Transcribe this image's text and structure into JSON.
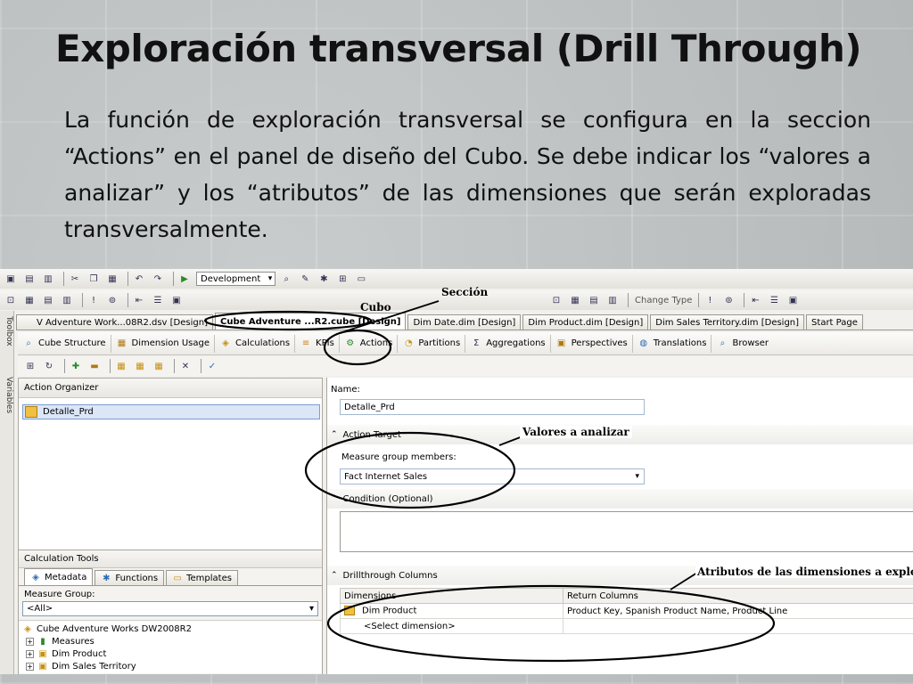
{
  "slide": {
    "title": "Exploración transversal (Drill Through)",
    "body": "La función de exploración transversal se configura en la seccion “Actions” en el panel de diseño del Cubo. Se debe indicar los “valores a analizar” y los “atributos” de las dimensiones que serán exploradas transversalmente."
  },
  "toolbar": {
    "config_dropdown": "Development",
    "change_type": "Change Type"
  },
  "side": {
    "toolbox": "Toolbox",
    "variables": "Variables"
  },
  "doc_tabs": [
    "V Adventure Work...08R2.dsv [Design]",
    "Cube Adventure ...R2.cube [Design]",
    "Dim Date.dim [Design]",
    "Dim Product.dim [Design]",
    "Dim Sales Territory.dim [Design]",
    "Start Page"
  ],
  "design_tabs": [
    "Cube Structure",
    "Dimension Usage",
    "Calculations",
    "KPIs",
    "Actions",
    "Partitions",
    "Aggregations",
    "Perspectives",
    "Translations",
    "Browser"
  ],
  "left": {
    "organizer_title": "Action Organizer",
    "organizer_item": "Detalle_Prd",
    "calc_title": "Calculation Tools",
    "calc_tabs": [
      "Metadata",
      "Functions",
      "Templates"
    ],
    "measure_group_label": "Measure Group:",
    "measure_group_value": "<All>",
    "tree": [
      "Cube Adventure Works DW2008R2",
      "Measures",
      "Dim Product",
      "Dim Sales Territory"
    ]
  },
  "right": {
    "name_label": "Name:",
    "name_value": "Detalle_Prd",
    "action_target": "Action Target",
    "mg_members_label": "Measure group members:",
    "mg_members_value": "Fact Internet Sales",
    "condition": "Condition (Optional)",
    "drill_cols": "Drillthrough Columns",
    "col_dimensions": "Dimensions",
    "col_return": "Return Columns",
    "row1_dim": "Dim Product",
    "row1_return": "Product Key, Spanish Product Name, Product Line",
    "row2_dim": "<Select dimension>"
  },
  "annotations": {
    "seccion": "Sección",
    "cubo": "Cubo",
    "valores": "Valores a analizar",
    "atributos": "Atributos de las dimensiones a explorar"
  }
}
